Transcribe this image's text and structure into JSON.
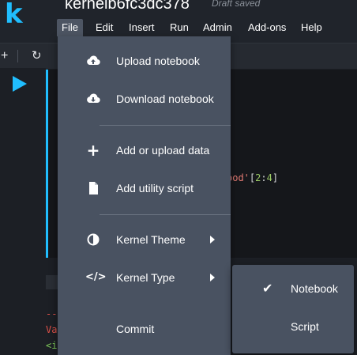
{
  "app": {
    "logo_letter": "k",
    "kernel_title": "kernelb6fc3dc378",
    "save_status": "Draft saved"
  },
  "menubar": {
    "items": [
      {
        "label": "File",
        "active": true
      },
      {
        "label": "Edit"
      },
      {
        "label": "Insert"
      },
      {
        "label": "Run"
      },
      {
        "label": "Admin"
      },
      {
        "label": "Add-ons"
      },
      {
        "label": "Help"
      }
    ]
  },
  "toolbar": {
    "add_icon": "plus-icon",
    "refresh_icon": "refresh-icon"
  },
  "cell": {
    "code_fragment": {
      "string": "ood'",
      "open": "[",
      "start": "2",
      "colon": ":",
      "end": "4",
      "close": "]"
    },
    "output_lines": [
      "--",
      "Va",
      "<i"
    ]
  },
  "file_menu": {
    "items": [
      {
        "label": "Upload notebook",
        "icon": "cloud-upload-icon"
      },
      {
        "label": "Download notebook",
        "icon": "cloud-download-icon"
      },
      {
        "label": "Add or upload data",
        "icon": "plus-icon"
      },
      {
        "label": "Add utility script",
        "icon": "file-icon"
      },
      {
        "label": "Kernel Theme",
        "icon": "half-circle-icon"
      },
      {
        "label": "Kernel Type",
        "icon": "code-icon"
      },
      {
        "label": "Commit"
      }
    ]
  },
  "kernel_type_submenu": {
    "items": [
      {
        "label": "Notebook",
        "checked": true
      },
      {
        "label": "Script",
        "checked": false
      }
    ]
  },
  "colors": {
    "accent": "#20beff",
    "menu_bg": "#495261",
    "topbar_bg": "#20242b"
  }
}
